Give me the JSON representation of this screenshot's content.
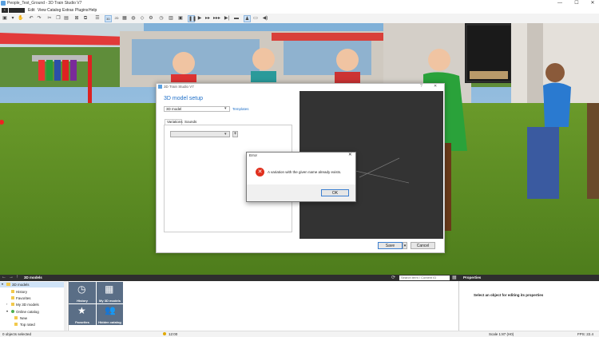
{
  "window": {
    "title": "People_Test_Ground - 3D Train Studio V7",
    "minimize": "—",
    "maximize": "☐",
    "close": "✕"
  },
  "menubar": {
    "items": [
      "Edit",
      "View",
      "Catalog",
      "Extras",
      "Plugins",
      "Help"
    ]
  },
  "toolbar": {
    "view_3d": "3D",
    "view_2d": "2D"
  },
  "dialog": {
    "title": "3D Train Studio V7",
    "help": "?",
    "close": "✕",
    "heading": "3D model setup",
    "model_select": "3D model",
    "templates_link": "Templates",
    "tabs": [
      "Variations",
      "Sounds"
    ],
    "variation_select": "",
    "add_button": "+",
    "save_button": "Save",
    "cancel_button": "Cancel"
  },
  "error": {
    "title": "Error",
    "close": "✕",
    "message": "A variation with the given name already exists.",
    "ok_button": "OK"
  },
  "catalog": {
    "header": "3D models",
    "search_placeholder": "Search term / Content ID",
    "tree": [
      {
        "label": "3D models",
        "level": 0,
        "selected": true
      },
      {
        "label": "History",
        "level": 1
      },
      {
        "label": "Favorites",
        "level": 1
      },
      {
        "label": "My 3D models",
        "level": 1
      },
      {
        "label": "Online catalog",
        "level": 1
      },
      {
        "label": "New",
        "level": 2
      },
      {
        "label": "Top rated",
        "level": 2
      }
    ],
    "tiles": [
      "History",
      "My 3D models",
      "Favorites",
      "Hidden catalog"
    ]
  },
  "properties": {
    "header": "Properties",
    "empty_text": "Select an object for editing its properties"
  },
  "statusbar": {
    "selection": "0 objects selected",
    "time": "12:00",
    "scale": "Scale 1:87 (H0)",
    "fps": "FPS: 22.4"
  },
  "colors": {
    "accent_blue": "#1e6fc8",
    "error_red": "#e0301e",
    "panel_dark": "#333333"
  }
}
